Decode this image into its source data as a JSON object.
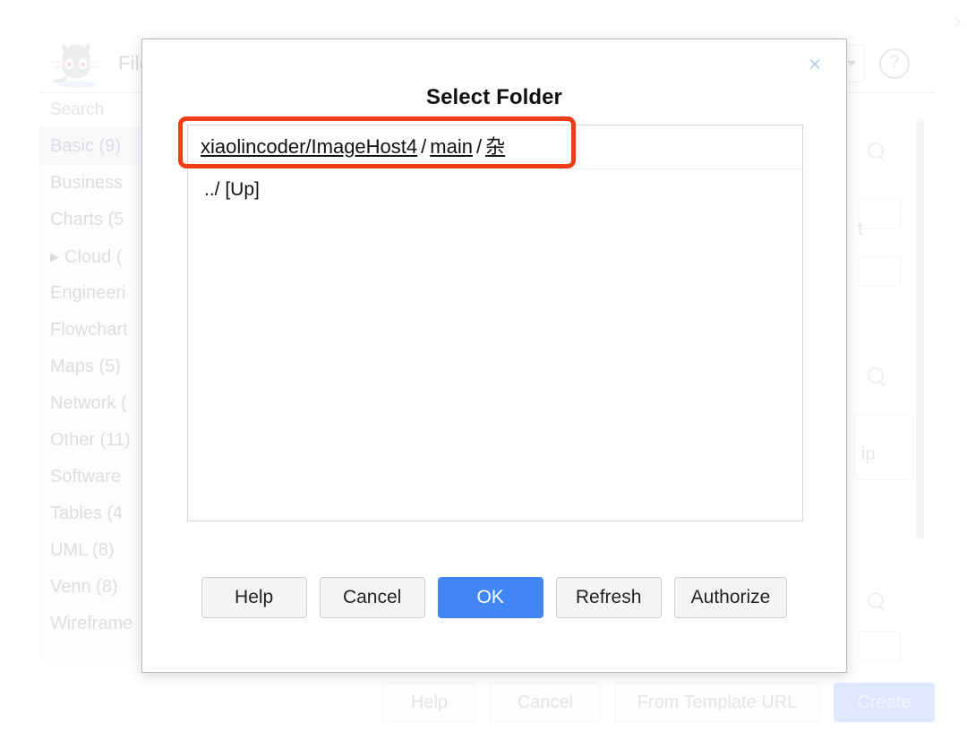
{
  "background": {
    "page_chevron_icon": "chevron-right-icon",
    "header": {
      "logo_icon": "github-octocat-logo",
      "file_menu_label": "File",
      "caret_icon": "chevron-down-icon",
      "help_icon": "question-circle-icon"
    },
    "sidebar": {
      "search_placeholder": "Search",
      "items": [
        {
          "label": "Basic (9)",
          "expandable": false,
          "selected": true
        },
        {
          "label": "Business",
          "expandable": false,
          "selected": false
        },
        {
          "label": "Charts (5",
          "expandable": false,
          "selected": false
        },
        {
          "label": "Cloud (",
          "expandable": true,
          "selected": false
        },
        {
          "label": "Engineeri",
          "expandable": false,
          "selected": false
        },
        {
          "label": "Flowchart",
          "expandable": false,
          "selected": false
        },
        {
          "label": "Maps (5)",
          "expandable": false,
          "selected": false
        },
        {
          "label": "Network (",
          "expandable": false,
          "selected": false
        },
        {
          "label": "Other (11)",
          "expandable": false,
          "selected": false
        },
        {
          "label": "Software",
          "expandable": false,
          "selected": false
        },
        {
          "label": "Tables (4",
          "expandable": false,
          "selected": false
        },
        {
          "label": "UML (8)",
          "expandable": false,
          "selected": false
        },
        {
          "label": "Venn (8)",
          "expandable": false,
          "selected": false
        },
        {
          "label": "Wireframe",
          "expandable": false,
          "selected": false
        }
      ]
    },
    "form_column": {
      "search_icon": "search-icon",
      "fragment_t": "t",
      "fragment_ip": "ip"
    },
    "footer_buttons": [
      {
        "label": "Help",
        "primary": false
      },
      {
        "label": "Cancel",
        "primary": false
      },
      {
        "label": "From Template URL",
        "primary": false
      },
      {
        "label": "Create",
        "primary": true
      }
    ]
  },
  "modal": {
    "title": "Select Folder",
    "close_icon": "close-icon",
    "breadcrumb": {
      "segments": [
        {
          "label": "xiaolincoder/ImageHost4",
          "link": true
        },
        {
          "label": "main",
          "link": true
        },
        {
          "label": "杂",
          "link": true
        }
      ],
      "separator": "/",
      "highlight_color": "#f23d13"
    },
    "file_entries": [
      {
        "label": "../ [Up]"
      }
    ],
    "footer_buttons": [
      {
        "label": "Help",
        "primary": false
      },
      {
        "label": "Cancel",
        "primary": false
      },
      {
        "label": "OK",
        "primary": true
      },
      {
        "label": "Refresh",
        "primary": false
      },
      {
        "label": "Authorize",
        "primary": false
      }
    ],
    "primary_color": "#4285f4"
  }
}
